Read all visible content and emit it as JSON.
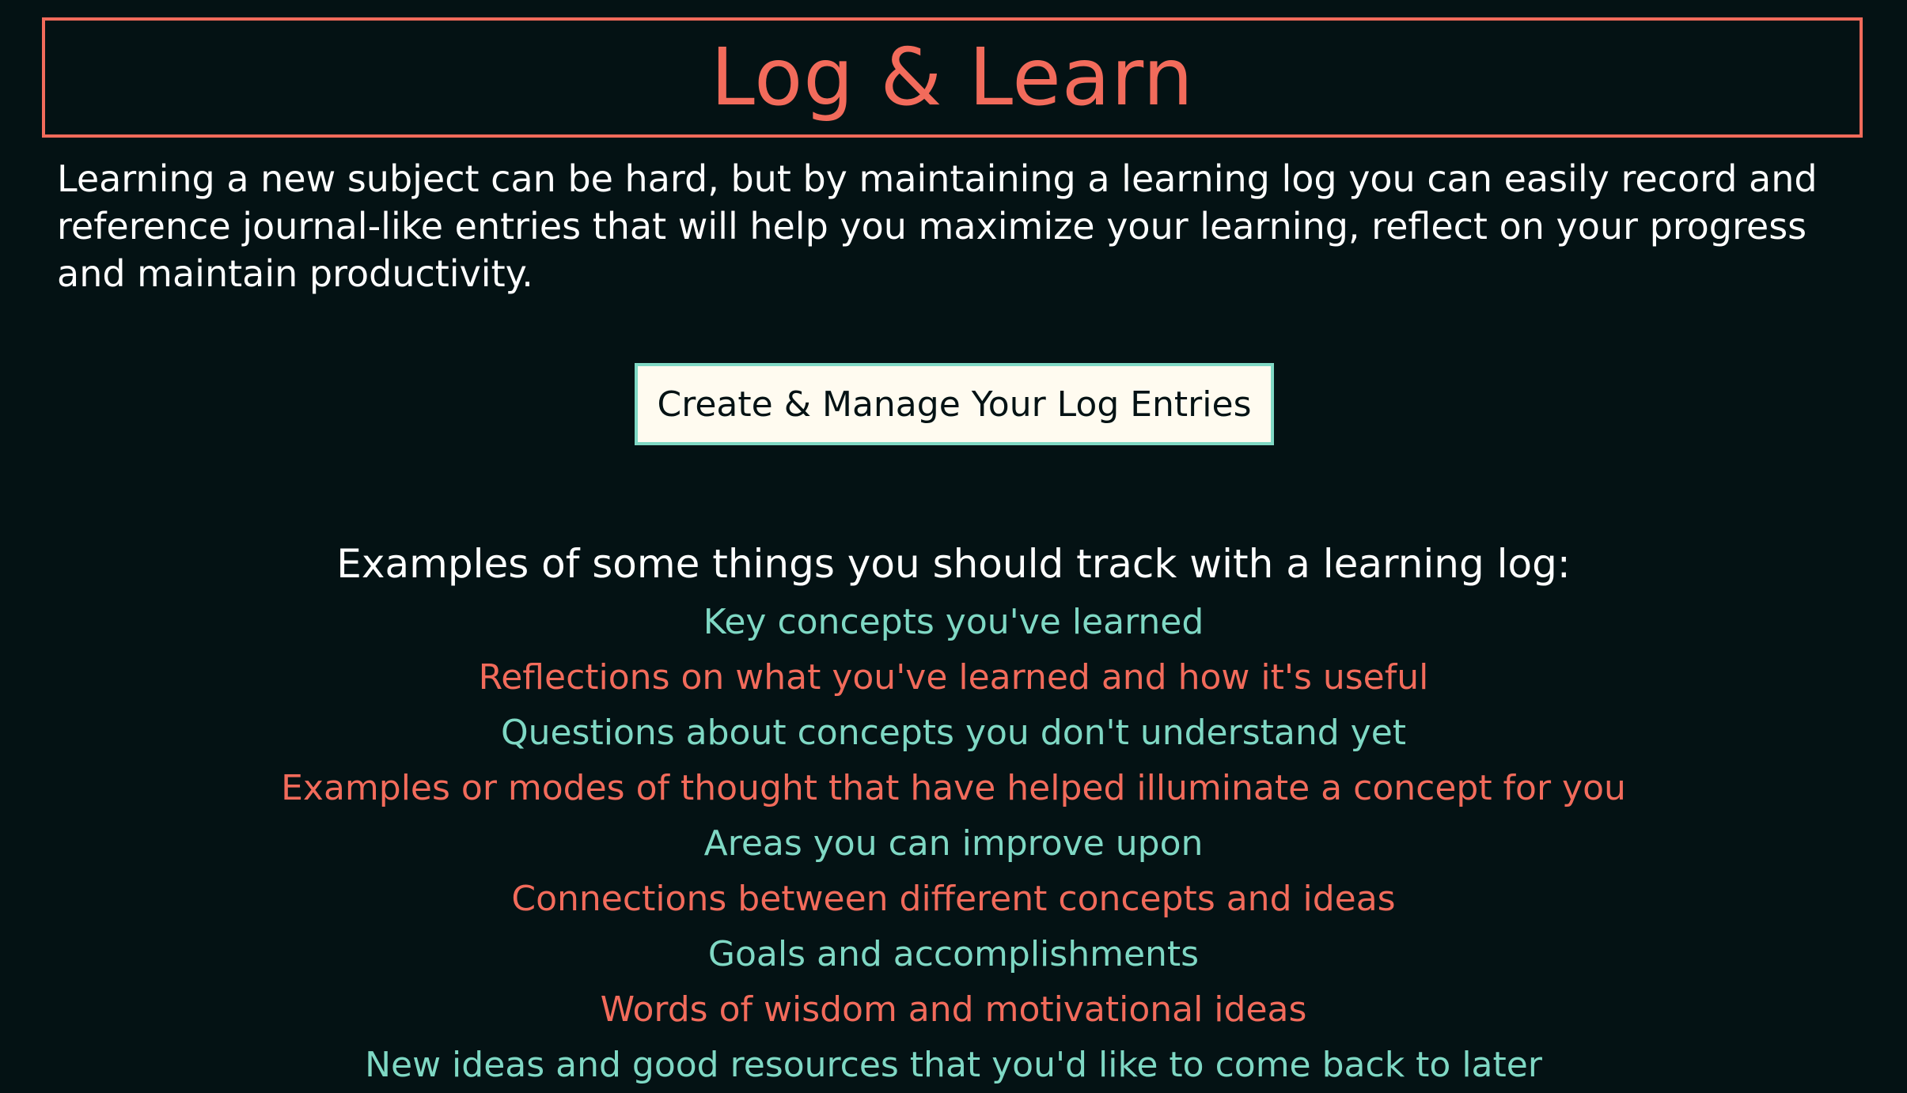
{
  "header": {
    "title": "Log & Learn"
  },
  "intro": {
    "text": "Learning a new subject can be hard, but by maintaining a learning log you can easily record and reference journal-like entries that will help you maximize your learning, reflect on your progress and maintain productivity."
  },
  "cta": {
    "label": "Create & Manage Your Log Entries"
  },
  "examples": {
    "heading": "Examples of some things you should track with a learning log:",
    "items": [
      "Key concepts you've learned",
      "Reflections on what you've learned and how it's useful",
      "Questions about concepts you don't understand yet",
      "Examples or modes of thought that have helped illuminate a concept for you",
      "Areas you can improve upon",
      "Connections between different concepts and ideas",
      "Goals and accomplishments",
      "Words of wisdom and motivational ideas",
      "New ideas and good resources that you'd like to come back to later"
    ]
  },
  "colors": {
    "background": "#041214",
    "accent_coral": "#f26b5b",
    "accent_teal": "#7fd8c4",
    "button_background": "#fffbf0",
    "text": "#ffffff"
  }
}
